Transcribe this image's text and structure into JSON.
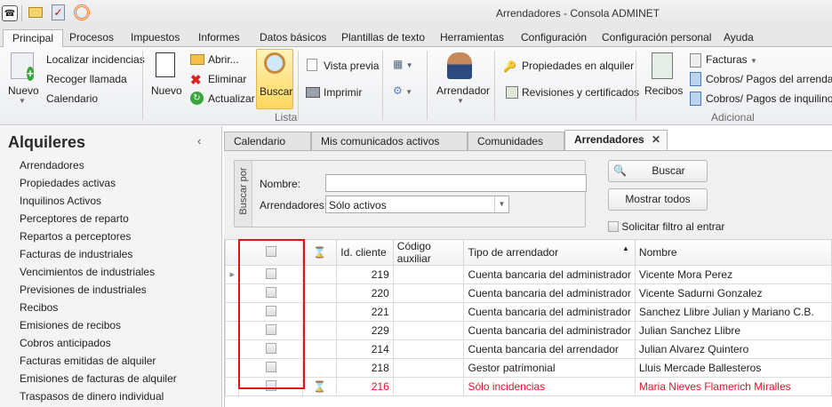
{
  "window": {
    "title": "Arrendadores - Consola ADMINET"
  },
  "quick_access": [
    "app-icon",
    "mail-icon",
    "clipboard-check-icon",
    "signal-icon"
  ],
  "ribbon_tabs": [
    "Principal",
    "Procesos",
    "Impuestos",
    "Informes",
    "Datos básicos",
    "Plantillas de texto",
    "Herramientas",
    "Configuración",
    "Configuración personal",
    "Ayuda"
  ],
  "ribbon": {
    "nuevo_main": "Nuevo",
    "localizar": "Localizar incidencias",
    "recoger": "Recoger llamada",
    "calendario": "Calendario",
    "nuevo": "Nuevo",
    "abrir": "Abrir...",
    "eliminar": "Eliminar",
    "actualizar": "Actualizar",
    "buscar": "Buscar",
    "vista_previa": "Vista previa",
    "imprimir": "Imprimir",
    "group_lista": "Lista",
    "arrendador": "Arrendador",
    "propiedades": "Propiedades en alquiler",
    "revisiones": "Revisiones y certificados",
    "recibos": "Recibos",
    "facturas": "Facturas",
    "cobros_arrendador": "Cobros/ Pagos del arrendador",
    "cobros_inquilinos": "Cobros/ Pagos de inquilinos",
    "group_adicional": "Adicional"
  },
  "sidebar": {
    "title": "Alquileres",
    "items": [
      "Arrendadores",
      "Propiedades activas",
      "Inquilinos Activos",
      "Perceptores de reparto",
      "Repartos a perceptores",
      "Facturas de industriales",
      "Vencimientos de industriales",
      "Previsiones de industriales",
      "Recibos",
      "Emisiones de recibos",
      "Cobros anticipados",
      "Facturas emitidas de alquiler",
      "Emisiones de facturas de alquiler",
      "Traspasos de dinero individual"
    ]
  },
  "doc_tabs": [
    "Calendario",
    "Mis comunicados activos",
    "Comunidades",
    "Arrendadores"
  ],
  "search": {
    "group_label": "Buscar por",
    "nombre_label": "Nombre:",
    "nombre_value": "",
    "arrendadores_label": "Arrendadores:",
    "arrendadores_value": "Sólo activos",
    "buscar": "Buscar",
    "mostrar_todos": "Mostrar todos",
    "solicitar_filtro": "Solicitar filtro al entrar"
  },
  "grid": {
    "columns": [
      "",
      "",
      "Id. cliente",
      "Código auxiliar",
      "Tipo de arrendador",
      "Nombre"
    ],
    "rows": [
      {
        "id": "219",
        "codigo": "",
        "tipo": "Cuenta bancaria del administrador",
        "nombre": "Vicente Mora Perez",
        "pending": false
      },
      {
        "id": "220",
        "codigo": "",
        "tipo": "Cuenta bancaria del administrador",
        "nombre": "Vicente Sadurni Gonzalez",
        "pending": false
      },
      {
        "id": "221",
        "codigo": "",
        "tipo": "Cuenta bancaria del administrador",
        "nombre": "Sanchez Llibre Julian y Mariano C.B.",
        "pending": false
      },
      {
        "id": "229",
        "codigo": "",
        "tipo": "Cuenta bancaria del administrador",
        "nombre": "Julian Sanchez Llibre",
        "pending": false
      },
      {
        "id": "214",
        "codigo": "",
        "tipo": "Cuenta bancaria del arrendador",
        "nombre": "Julian Alvarez Quintero",
        "pending": false
      },
      {
        "id": "218",
        "codigo": "",
        "tipo": "Gestor patrimonial",
        "nombre": "Lluis Mercade Ballesteros",
        "pending": false
      },
      {
        "id": "216",
        "codigo": "",
        "tipo": "Sólo incidencias",
        "nombre": "Maria Nieves Flamerich Miralles",
        "pending": true
      }
    ]
  },
  "colors": {
    "highlight": "#e21414",
    "pending_row": "#e8102a"
  }
}
